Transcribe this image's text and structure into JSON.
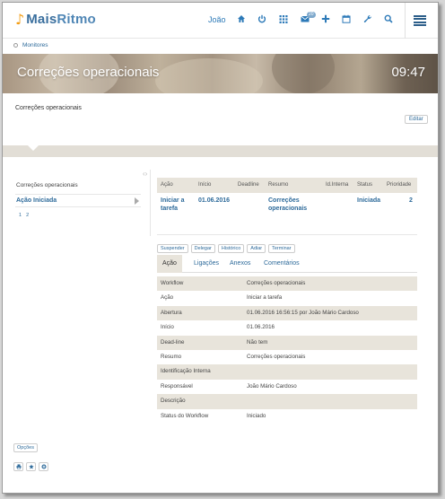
{
  "header": {
    "brand": {
      "first": "Mais",
      "second": "Ritmo"
    },
    "user": "João",
    "icons": [
      "home-icon",
      "power-icon",
      "apps-grid-icon",
      "mail-icon",
      "plus-icon",
      "calendar-icon",
      "wrench-icon",
      "search-icon",
      "menu-icon"
    ],
    "mail_badge": "20"
  },
  "breadcrumb": {
    "link": "Monitores"
  },
  "banner": {
    "title": "Correções operacionais",
    "clock": "09:47"
  },
  "description": {
    "text": "Correções operacionais",
    "edit_label": "Editar"
  },
  "sidebar": {
    "title": "Correções operacionais",
    "item": "Ação Iniciada",
    "pages": [
      "1",
      "2"
    ]
  },
  "list": {
    "columns": [
      "Ação",
      "Início",
      "Deadline",
      "Resumo",
      "Id.Interna",
      "Status",
      "Prioridade"
    ],
    "row": {
      "acao": "Iniciar a tarefa",
      "inicio": "01.06.2016",
      "deadline": "",
      "resumo": "Correções operacionais",
      "id_interna": "",
      "status": "Iniciada",
      "prioridade": "2"
    }
  },
  "actions": [
    "Suspender",
    "Delegar",
    "Histórico",
    "Adiar",
    "Terminar"
  ],
  "tabs": [
    "Ação",
    "Ligações",
    "Anexos",
    "Comentários"
  ],
  "details": [
    {
      "label": "Workflow",
      "value": "Correções operacionais"
    },
    {
      "label": "Ação",
      "value": "Iniciar a tarefa"
    },
    {
      "label": "Abertura",
      "value": "01.06.2016 16:56:15 por João Mário Cardoso"
    },
    {
      "label": "Início",
      "value": "01.06.2016"
    },
    {
      "label": "Dead-line",
      "value": "Não tem"
    },
    {
      "label": "Resumo",
      "value": "Correções operacionais"
    },
    {
      "label": "Identificação Interna",
      "value": ""
    },
    {
      "label": "Responsável",
      "value": "João Mário Cardoso"
    },
    {
      "label": "Descrição",
      "value": ""
    },
    {
      "label": "Status do Workflow",
      "value": "Iniciado"
    }
  ],
  "footer": {
    "options_label": "Opções",
    "icons": [
      "print-icon",
      "star-icon",
      "settings-icon"
    ]
  },
  "colors": {
    "accent": "#2d6a9a",
    "logo_note": "#f39c12",
    "shade": "#e8e4db"
  }
}
